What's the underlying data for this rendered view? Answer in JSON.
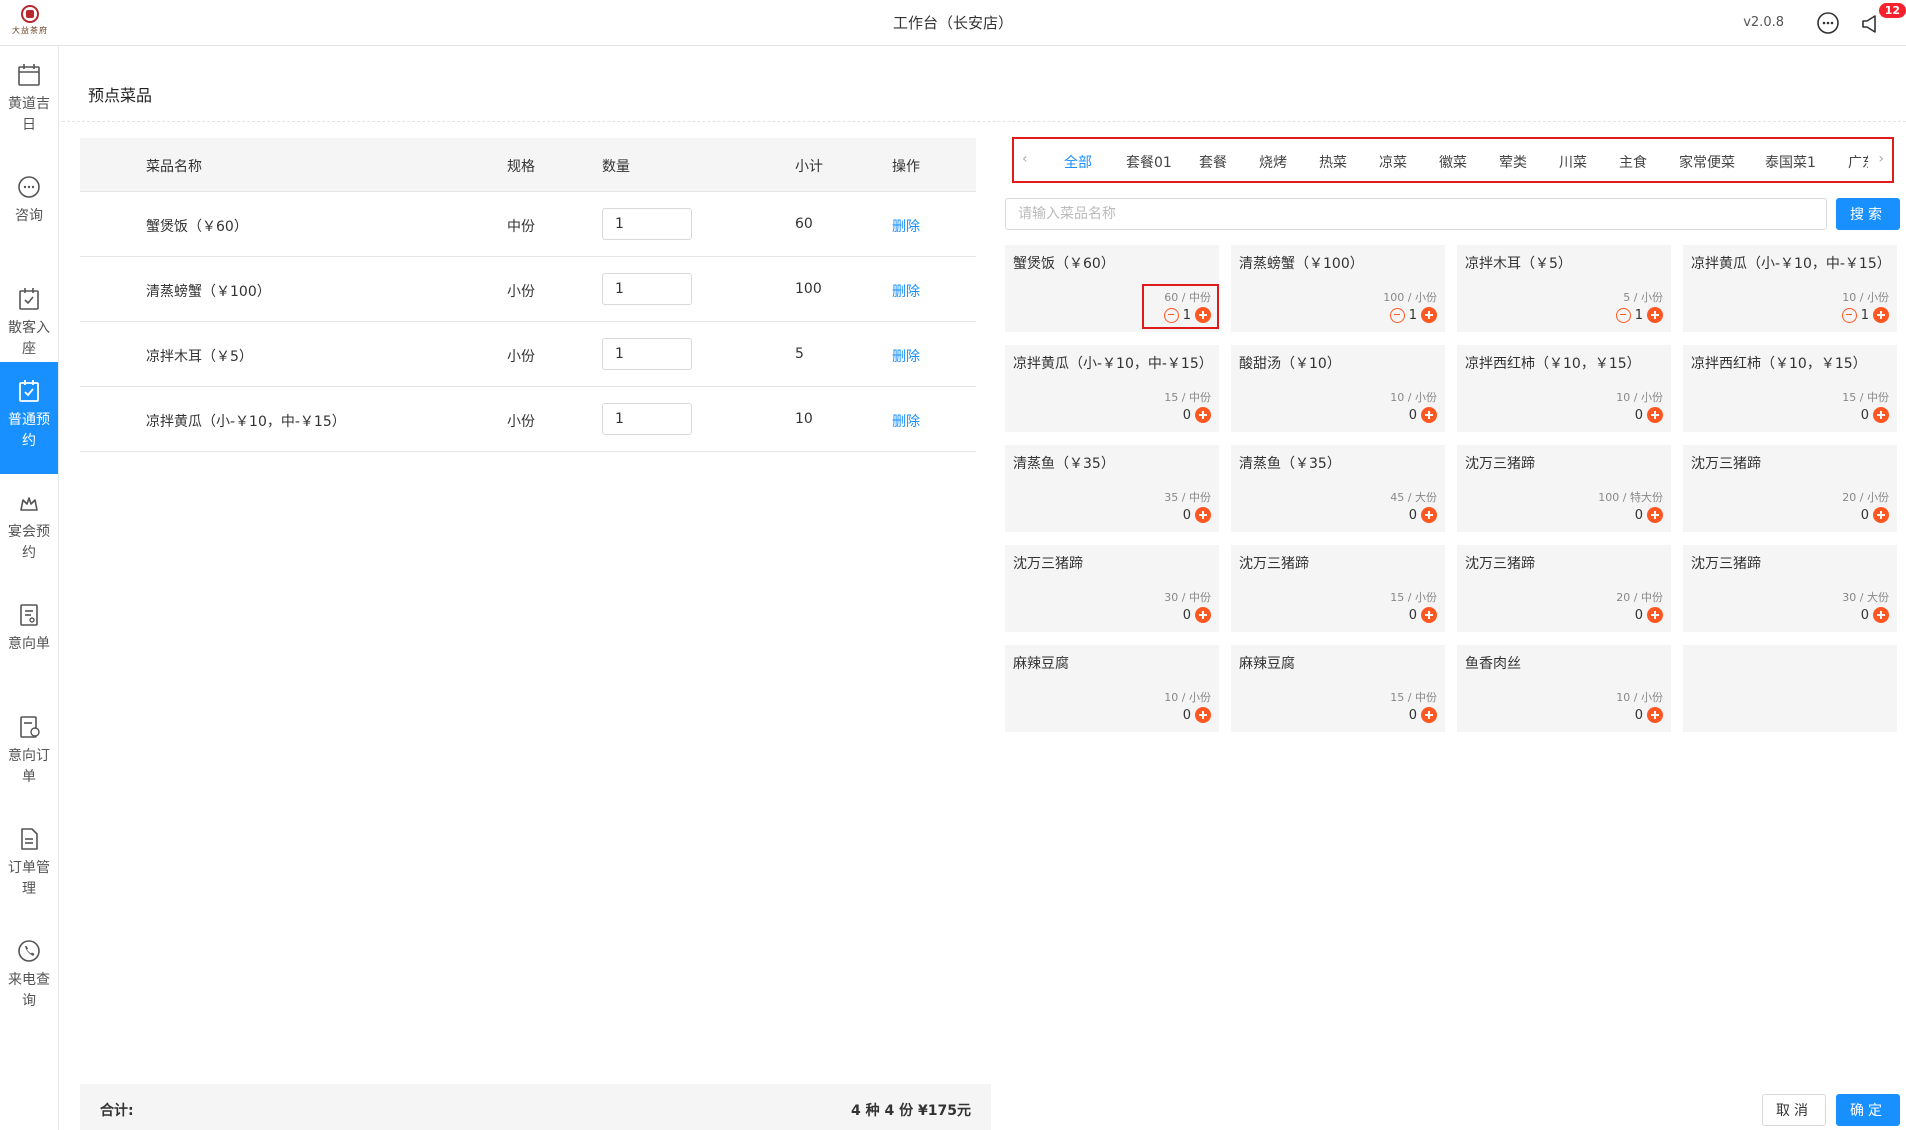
{
  "header": {
    "logo_text": "大益茶府",
    "title": "工作台（长安店）",
    "version": "v2.0.8",
    "notification_count": "12"
  },
  "sidebar": {
    "items": [
      {
        "label": "黄道吉日",
        "icon": "calendar-icon"
      },
      {
        "label": "咨询",
        "icon": "chat-icon"
      },
      {
        "label": "散客入座",
        "icon": "checkin-icon"
      },
      {
        "label": "普通预约",
        "icon": "reserve-icon",
        "active": true
      },
      {
        "label": "宴会预约",
        "icon": "banquet-icon"
      },
      {
        "label": "意向单",
        "icon": "intent-icon"
      },
      {
        "label": "意向订单",
        "icon": "intent-order-icon"
      },
      {
        "label": "订单管理",
        "icon": "order-icon"
      },
      {
        "label": "来电查询",
        "icon": "phone-icon"
      }
    ]
  },
  "page": {
    "title": "预点菜品"
  },
  "table": {
    "headers": [
      "菜品名称",
      "规格",
      "数量",
      "小计",
      "操作"
    ],
    "rows": [
      {
        "name": "蟹煲饭（￥60）",
        "spec": "中份",
        "qty": "1",
        "subtotal": "60",
        "action": "删除"
      },
      {
        "name": "清蒸螃蟹（￥100）",
        "spec": "小份",
        "qty": "1",
        "subtotal": "100",
        "action": "删除"
      },
      {
        "name": "凉拌木耳（￥5）",
        "spec": "小份",
        "qty": "1",
        "subtotal": "5",
        "action": "删除"
      },
      {
        "name": "凉拌黄瓜（小-￥10，中-￥15）",
        "spec": "小份",
        "qty": "1",
        "subtotal": "10",
        "action": "删除"
      }
    ]
  },
  "footer": {
    "total_label": "合计:",
    "total_value": "4 种 4 份 ¥175元"
  },
  "categories": {
    "tabs": [
      "全部",
      "套餐01",
      "套餐",
      "烧烤",
      "热菜",
      "凉菜",
      "徽菜",
      "荤类",
      "川菜",
      "主食",
      "家常便菜",
      "泰国菜1",
      "广东菜"
    ],
    "active": "全部"
  },
  "search": {
    "placeholder": "请输入菜品名称",
    "button": "搜索"
  },
  "dishes": [
    {
      "name": "蟹煲饭（￥60）",
      "meta": "60 / 中份",
      "count": "1",
      "minus": true
    },
    {
      "name": "清蒸螃蟹（￥100）",
      "meta": "100 / 小份",
      "count": "1",
      "minus": true
    },
    {
      "name": "凉拌木耳（￥5）",
      "meta": "5 / 小份",
      "count": "1",
      "minus": true
    },
    {
      "name": "凉拌黄瓜（小-￥10，中-￥15）",
      "meta": "10 / 小份",
      "count": "1",
      "minus": true
    },
    {
      "name": "凉拌黄瓜（小-￥10，中-￥15）",
      "meta": "15 / 中份",
      "count": "0",
      "minus": false
    },
    {
      "name": "酸甜汤（￥10）",
      "meta": "10 / 小份",
      "count": "0",
      "minus": false
    },
    {
      "name": "凉拌西红柿（￥10，￥15）",
      "meta": "10 / 小份",
      "count": "0",
      "minus": false
    },
    {
      "name": "凉拌西红柿（￥10，￥15）",
      "meta": "15 / 中份",
      "count": "0",
      "minus": false
    },
    {
      "name": "清蒸鱼（￥35）",
      "meta": "35 / 中份",
      "count": "0",
      "minus": false
    },
    {
      "name": "清蒸鱼（￥35）",
      "meta": "45 / 大份",
      "count": "0",
      "minus": false
    },
    {
      "name": "沈万三猪蹄",
      "meta": "100 / 特大份",
      "count": "0",
      "minus": false
    },
    {
      "name": "沈万三猪蹄",
      "meta": "20 / 小份",
      "count": "0",
      "minus": false
    },
    {
      "name": "沈万三猪蹄",
      "meta": "30 / 中份",
      "count": "0",
      "minus": false
    },
    {
      "name": "沈万三猪蹄",
      "meta": "15 / 小份",
      "count": "0",
      "minus": false
    },
    {
      "name": "沈万三猪蹄",
      "meta": "20 / 中份",
      "count": "0",
      "minus": false
    },
    {
      "name": "沈万三猪蹄",
      "meta": "30 / 大份",
      "count": "0",
      "minus": false
    },
    {
      "name": "麻辣豆腐",
      "meta": "10 / 小份",
      "count": "0",
      "minus": false
    },
    {
      "name": "麻辣豆腐",
      "meta": "15 / 中份",
      "count": "0",
      "minus": false
    },
    {
      "name": "鱼香肉丝",
      "meta": "10 / 小份",
      "count": "0",
      "minus": false
    },
    {
      "name": "",
      "meta": "",
      "count": "",
      "minus": false,
      "empty": true
    }
  ],
  "buttons": {
    "cancel": "取消",
    "confirm": "确定"
  },
  "colors": {
    "primary": "#1890ff",
    "accent": "#ff5722",
    "highlight": "#e01b1b",
    "badge": "#f5222d"
  }
}
